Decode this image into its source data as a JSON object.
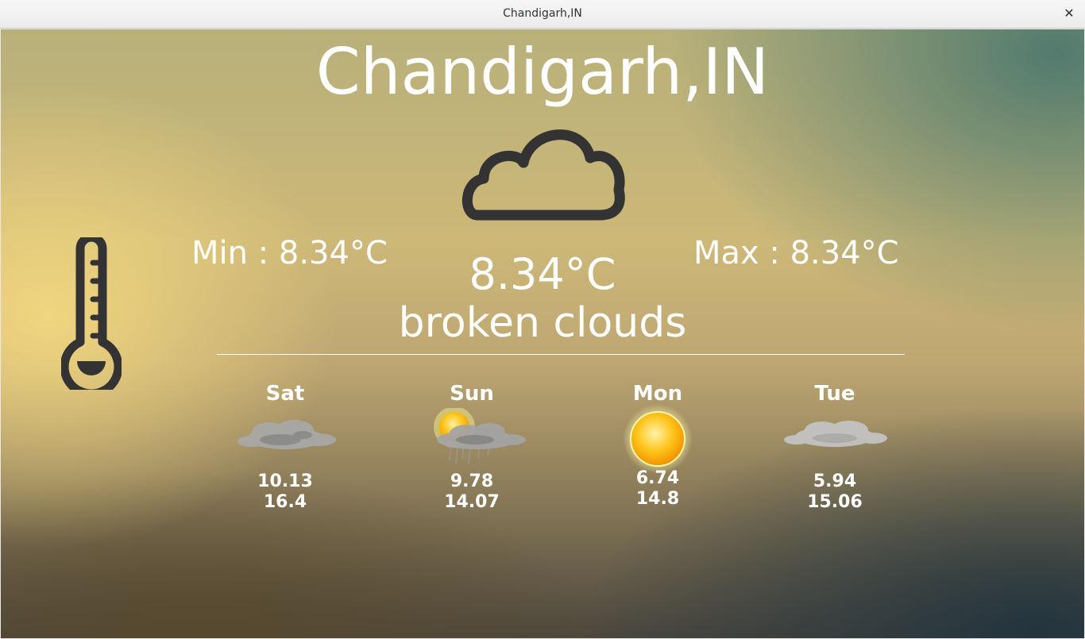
{
  "window": {
    "title": "Chandigarh,IN",
    "close_glyph": "✕"
  },
  "weather": {
    "city": "Chandigarh,IN",
    "main_icon": "cloud-icon",
    "temp_icon": "thermometer-icon",
    "min": "Min : 8.34°C",
    "max": "Max : 8.34°C",
    "current": "8.34°C",
    "description": "broken clouds"
  },
  "forecast": [
    {
      "day": "Sat",
      "icon": "broken-clouds-icon",
      "low": "10.13",
      "high": "16.4"
    },
    {
      "day": "Sun",
      "icon": "sun-clouds-rain-icon",
      "low": "9.78",
      "high": "14.07"
    },
    {
      "day": "Mon",
      "icon": "sun-icon",
      "low": "6.74",
      "high": "14.8"
    },
    {
      "day": "Tue",
      "icon": "overcast-clouds-icon",
      "low": "5.94",
      "high": "15.06"
    }
  ],
  "colors": {
    "icon_dark": "#333333",
    "text": "#ffffff"
  }
}
